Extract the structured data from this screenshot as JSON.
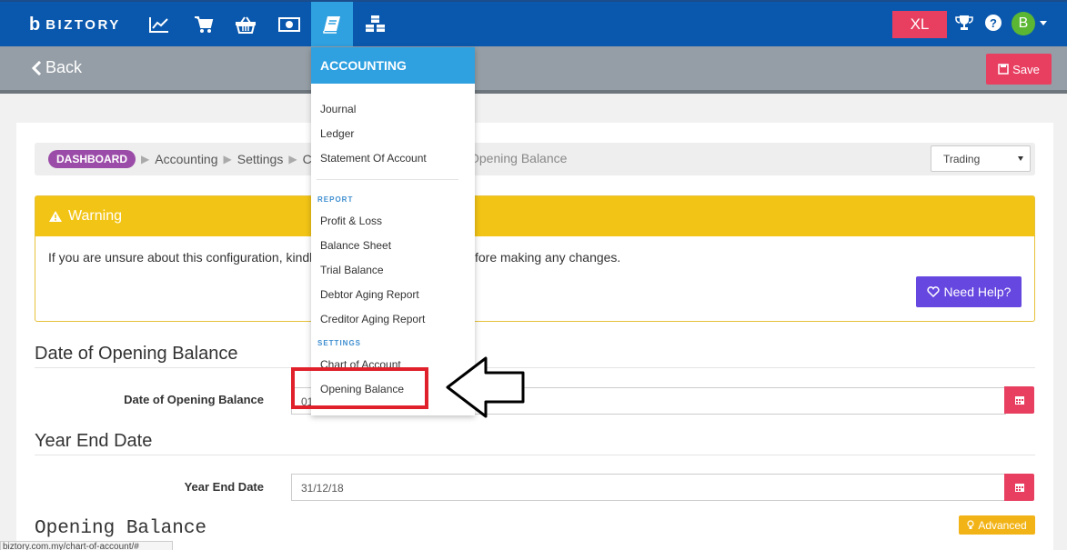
{
  "brand": {
    "mark": "b",
    "name": "BIZTORY"
  },
  "nav": {
    "icons": [
      "chart-line-icon",
      "cart-icon",
      "basket-icon",
      "money-icon",
      "book-icon",
      "cubes-icon"
    ],
    "active": "book-icon",
    "xl_label": "XL",
    "avatar_initial": "B"
  },
  "subbar": {
    "back_label": "Back",
    "save_label": "Save"
  },
  "breadcrumb": {
    "dashboard": "DASHBOARD",
    "items": [
      "Accounting",
      "Settings",
      "C"
    ],
    "last": "Opening Balance"
  },
  "select": {
    "value": "Trading"
  },
  "warning": {
    "title": "Warning",
    "text_left": "If you are unsure about this configuration, kindl",
    "text_right": "fore making any changes.",
    "help_label": "Need Help?"
  },
  "sections": {
    "date_opening": {
      "title": "Date of Opening Balance",
      "label": "Date of Opening Balance",
      "value": "01"
    },
    "year_end": {
      "title": "Year End Date",
      "label": "Year End Date",
      "value": "31/12/18"
    },
    "opening_balance": {
      "title": "Opening Balance",
      "advanced_label": "Advanced"
    }
  },
  "dropdown": {
    "header": "ACCOUNTING",
    "main_items": [
      "Journal",
      "Ledger",
      "Statement Of Account"
    ],
    "report_label": "REPORT",
    "report_items": [
      "Profit & Loss",
      "Balance Sheet",
      "Trial Balance",
      "Debtor Aging Report",
      "Creditor Aging Report"
    ],
    "settings_label": "SETTINGS",
    "settings_items": [
      "Chart of Account",
      "Opening Balance"
    ]
  },
  "status_url": "biztory.com.my/chart-of-account/#",
  "colors": {
    "nav": "#0a58ad",
    "active": "#2fa0e0",
    "accent": "#e83f61",
    "warning": "#f2c416",
    "help": "#6647e0",
    "annotation": "#e0202a"
  }
}
